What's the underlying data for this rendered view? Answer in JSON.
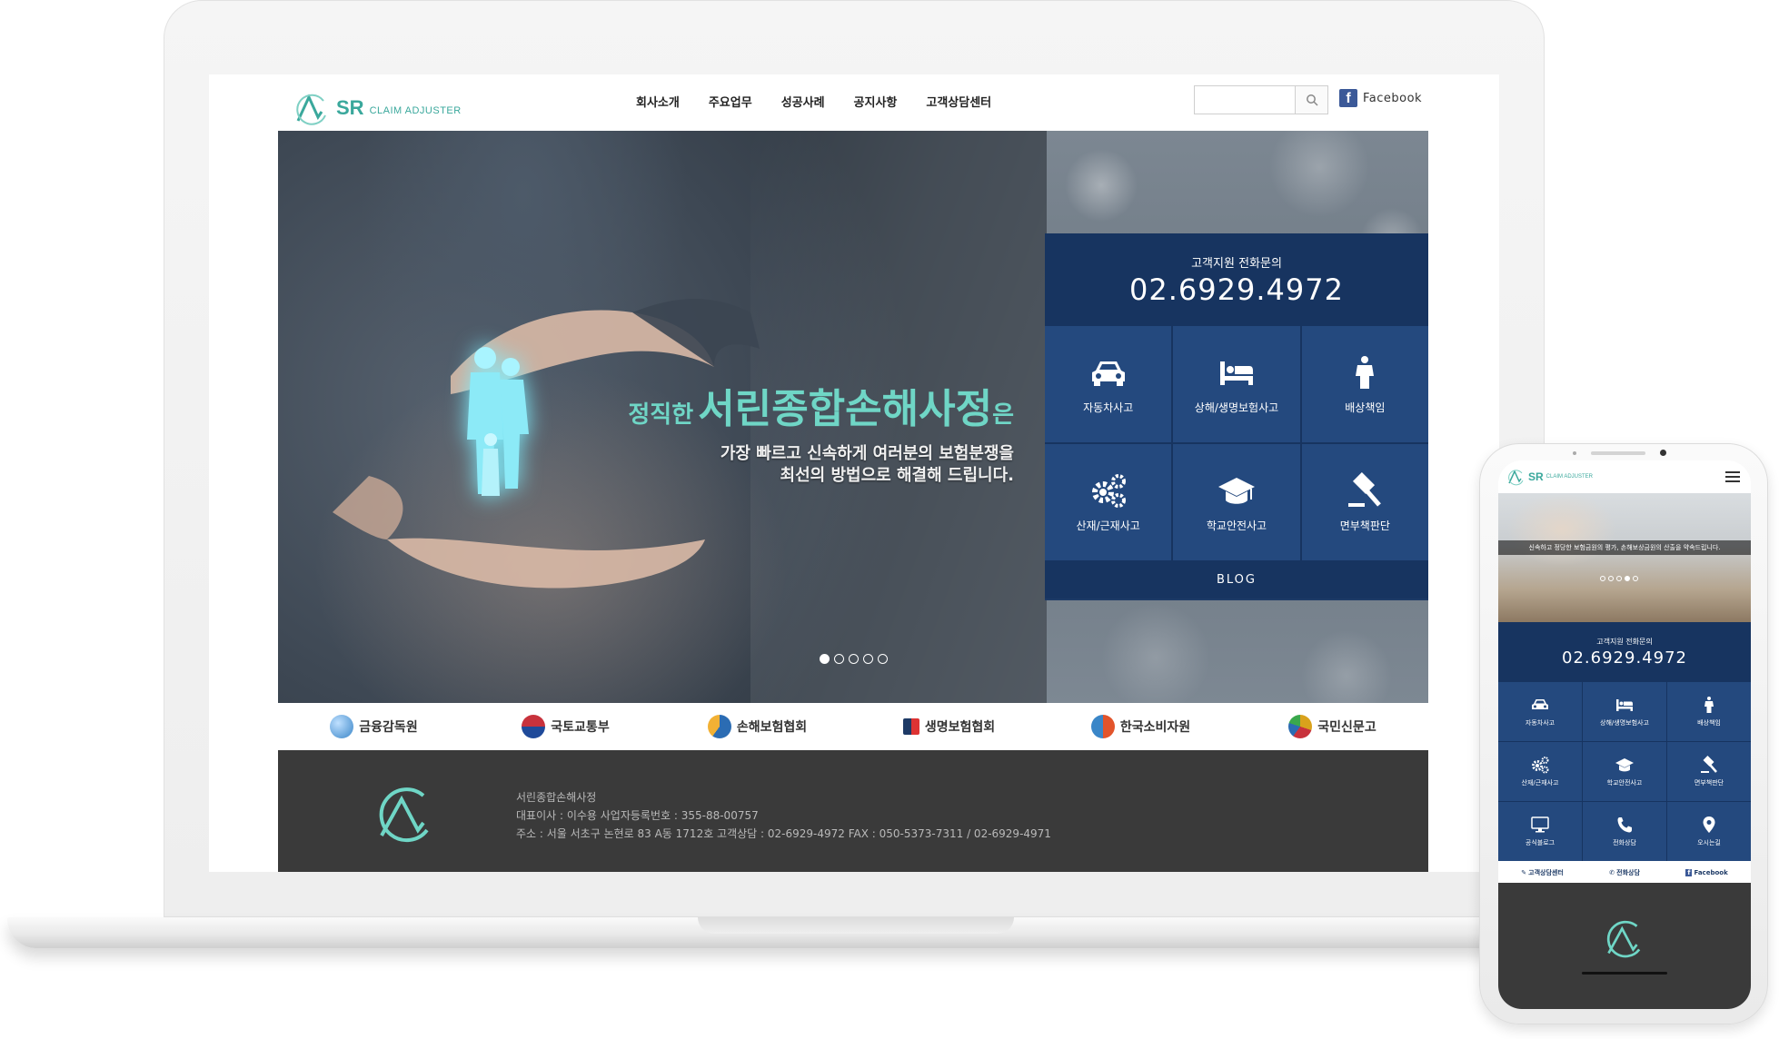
{
  "site": {
    "logo_mark": "SR",
    "logo_sub": "CLAIM ADJUSTER"
  },
  "nav": {
    "items": [
      "회사소개",
      "주요업무",
      "성공사례",
      "공지사항",
      "고객상담센터"
    ]
  },
  "search": {
    "value": "",
    "placeholder": ""
  },
  "facebook": {
    "label": "Facebook"
  },
  "hero": {
    "headline_prefix": "정직한",
    "headline_name": "서린종합손해사정",
    "headline_suffix": "은",
    "sub_line1": "가장 빠르고 신속하게 여러분의 보험분쟁을",
    "sub_line2": "최선의 방법으로 해결해 드립니다.",
    "slide_count": 5,
    "active_slide": 1
  },
  "service_panel": {
    "contact_label": "고객지원 전화문의",
    "phone": "02.6929.4972",
    "tiles": [
      {
        "label": "자동차사고",
        "icon": "car-icon"
      },
      {
        "label": "상해/생명보험사고",
        "icon": "bed-icon"
      },
      {
        "label": "배상책임",
        "icon": "person-icon"
      },
      {
        "label": "산재/근재사고",
        "icon": "gears-icon"
      },
      {
        "label": "학교안전사고",
        "icon": "graduation-cap-icon"
      },
      {
        "label": "면부책판단",
        "icon": "gavel-icon"
      }
    ],
    "blog_label": "BLOG"
  },
  "partners": [
    {
      "label": "금융감독원",
      "color": "#3a86c8"
    },
    {
      "label": "국토교통부",
      "color": "#c8323c"
    },
    {
      "label": "손해보험협회",
      "color": "#2b6cb3"
    },
    {
      "label": "생명보험협회",
      "color": "#1d3a66"
    },
    {
      "label": "한국소비자원",
      "color": "#e2542b"
    },
    {
      "label": "국민신문고",
      "color": "#d9a21c"
    }
  ],
  "footer": {
    "company": "서린종합손해사정",
    "line2": "대표이사 : 이수용    사업자등록번호 : 355-88-00757",
    "line3": "주소 : 서울 서초구 논현로 83 A동 1712호    고객상담 : 02-6929-4972    FAX : 050-5373-7311 / 02-6929-4971"
  },
  "mobile": {
    "hero_caption": "신속하고 정당한 보험금원의 평가, 손해보상금원의 산출을 약속드립니다.",
    "contact_label": "고객지원 전화문의",
    "phone": "02.6929.4972",
    "tiles": [
      {
        "label": "자동차사고",
        "icon": "car-icon"
      },
      {
        "label": "상해/생명보험사고",
        "icon": "bed-icon"
      },
      {
        "label": "배상책임",
        "icon": "person-icon"
      },
      {
        "label": "산재/근재사고",
        "icon": "gears-icon"
      },
      {
        "label": "학교안전사고",
        "icon": "graduation-cap-icon"
      },
      {
        "label": "면부책판단",
        "icon": "gavel-icon"
      },
      {
        "label": "공식블로그",
        "icon": "monitor-icon"
      },
      {
        "label": "전화상담",
        "icon": "phone-icon"
      },
      {
        "label": "오시는길",
        "icon": "map-pin-icon"
      }
    ],
    "bottom_links": [
      "고객상담센터",
      "전화상담",
      "Facebook"
    ]
  },
  "colors": {
    "brand_teal": "#3aa89c",
    "panel_navy": "#1d3a66",
    "tile_blue": "#24497e",
    "footer_dark": "#3a3a3a"
  }
}
